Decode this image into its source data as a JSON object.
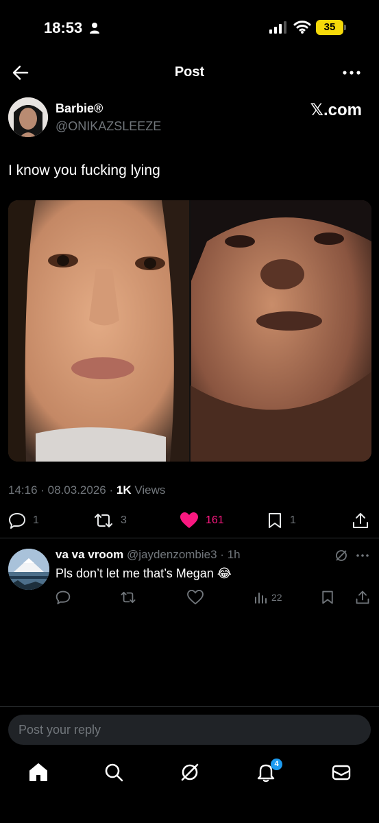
{
  "status_bar": {
    "time": "18:53",
    "battery": "35"
  },
  "header": {
    "title": "Post"
  },
  "author": {
    "name": "Barbie®",
    "handle": "@ONIKAZSLEEZE",
    "source": "𝕏.com"
  },
  "post": {
    "text": "I know you fucking lying",
    "time": "14:16",
    "date": "08.03.2026",
    "views_count": "1K",
    "views_label": "Views",
    "replies": "1",
    "reposts": "3",
    "likes": "161",
    "bookmarks": "1"
  },
  "reply": {
    "name": "va va vroom",
    "handle": "@jaydenzombie3",
    "time": "1h",
    "text": "Pls don’t let me that’s Megan 😂",
    "views": "22"
  },
  "composer": {
    "placeholder": "Post your reply"
  },
  "nav": {
    "notifications_badge": "4"
  },
  "colors": {
    "background": "#000000",
    "like": "#f91880",
    "accent": "#1d9bf0",
    "muted": "#71767b"
  }
}
